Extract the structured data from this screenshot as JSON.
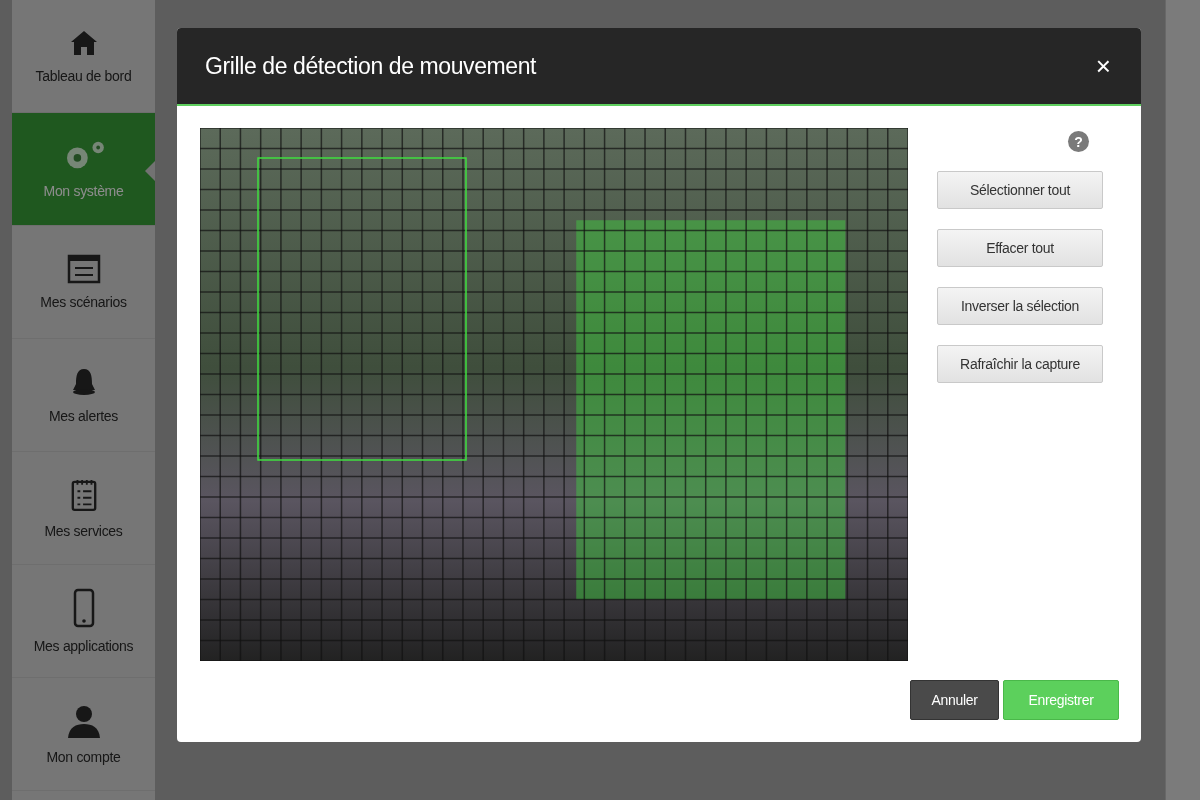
{
  "sidebar": {
    "items": [
      {
        "label": "Tableau de bord",
        "selected": false
      },
      {
        "label": "Mon système",
        "selected": true
      },
      {
        "label": "Mes scénarios",
        "selected": false
      },
      {
        "label": "Mes alertes",
        "selected": false
      },
      {
        "label": "Mes services",
        "selected": false
      },
      {
        "label": "Mes applications",
        "selected": false
      },
      {
        "label": "Mon compte",
        "selected": false
      }
    ]
  },
  "dialog": {
    "title": "Grille de détection de mouvement",
    "close": "×",
    "help": "?",
    "actions": [
      "Sélectionner tout",
      "Effacer tout",
      "Inverser la sélection",
      "Rafraîchir la capture"
    ],
    "footer_buttons": [
      {
        "label": "Annuler",
        "kind": "secondary"
      },
      {
        "label": "Enregistrer",
        "kind": "primary"
      }
    ]
  }
}
